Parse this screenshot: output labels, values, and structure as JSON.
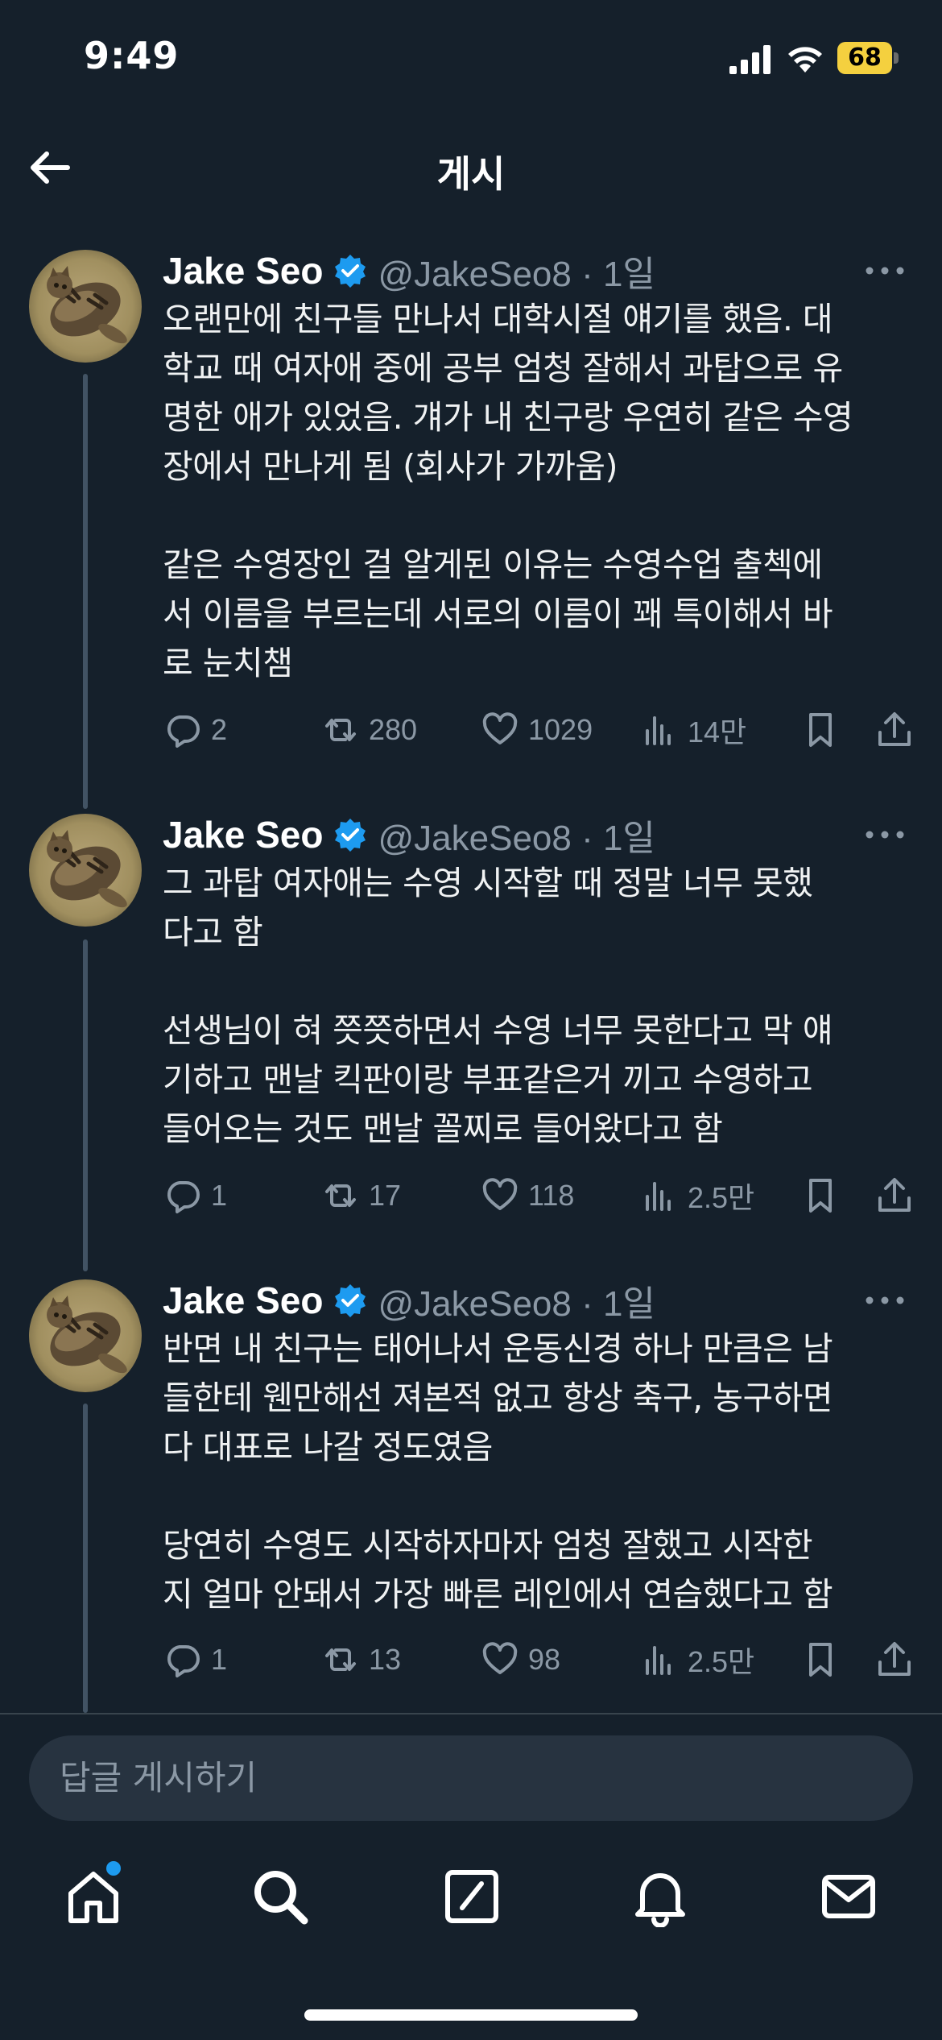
{
  "status": {
    "time": "9:49",
    "battery": "68",
    "icons": [
      "signal-icon",
      "wifi-icon",
      "battery-icon"
    ]
  },
  "header": {
    "title": "게시",
    "back_icon": "arrow-left-icon"
  },
  "posts": [
    {
      "author": "Jake Seo",
      "handle": "@JakeSeo8 · 1일",
      "lines": [
        "오랜만에 친구들 만나서 대학시절 얘기를 했음. 대",
        "학교 때 여자애 중에 공부 엄청 잘해서 과탑으로 유",
        "명한 애가 있었음. 걔가 내 친구랑 우연히 같은 수영",
        "장에서 만나게 됨 (회사가 가까움)",
        "",
        "같은 수영장인 걸 알게된 이유는 수영수업 출첵에",
        "서 이름을 부르는데 서로의 이름이 꽤 특이해서 바",
        "로 눈치챔"
      ],
      "replies": "2",
      "reposts": "280",
      "likes": "1029",
      "views": "14만"
    },
    {
      "author": "Jake Seo",
      "handle": "@JakeSeo8 · 1일",
      "lines": [
        "그 과탑 여자애는 수영 시작할 때 정말 너무 못했",
        "다고 함",
        "",
        "선생님이 혀 쯧쯧하면서 수영 너무 못한다고 막 얘",
        "기하고 맨날 킥판이랑 부표같은거 끼고 수영하고",
        "들어오는 것도 맨날 꼴찌로 들어왔다고 함"
      ],
      "replies": "1",
      "reposts": "17",
      "likes": "118",
      "views": "2.5만"
    },
    {
      "author": "Jake Seo",
      "handle": "@JakeSeo8 · 1일",
      "lines": [
        "반면 내 친구는 태어나서 운동신경 하나 만큼은 남",
        "들한테 웬만해선 져본적 없고 항상 축구, 농구하면",
        "다 대표로 나갈 정도였음",
        "",
        "당연히 수영도 시작하자마자 엄청 잘했고 시작한",
        "지 얼마 안돼서 가장 빠른 레인에서 연습했다고 함"
      ],
      "replies": "1",
      "reposts": "13",
      "likes": "98",
      "views": "2.5만"
    }
  ],
  "reply_bar": {
    "placeholder": "답글 게시하기"
  },
  "tab_bar": {
    "items": [
      "home-icon",
      "search-icon",
      "compose-icon",
      "notifications-icon",
      "messages-icon"
    ],
    "accent": "#1d9bf0"
  }
}
